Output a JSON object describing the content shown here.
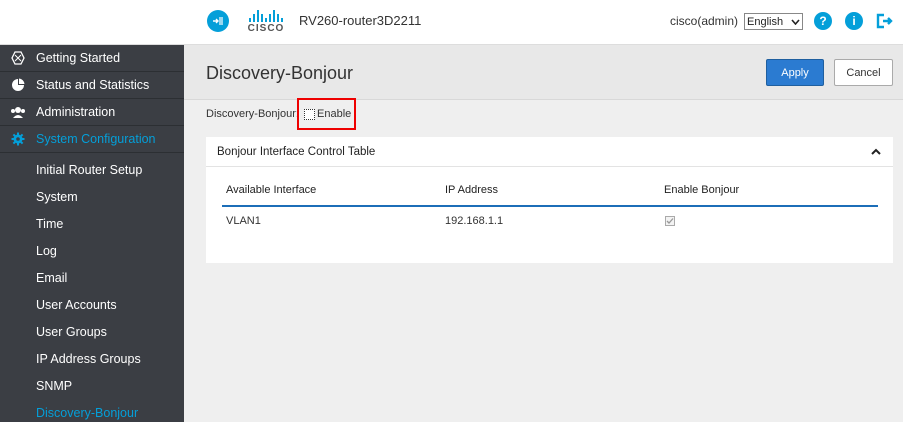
{
  "header": {
    "device_name": "RV260-router3D2211",
    "logo_text": "CISCO",
    "user": "cisco(admin)",
    "language": "English",
    "icons": [
      "nav-toggle-icon",
      "help-icon",
      "info-icon",
      "logout-icon"
    ]
  },
  "sidebar": {
    "items": [
      {
        "label": "Getting Started",
        "icon": "hexagon-icon"
      },
      {
        "label": "Status and Statistics",
        "icon": "pie-chart-icon"
      },
      {
        "label": "Administration",
        "icon": "users-icon"
      },
      {
        "label": "System Configuration",
        "icon": "gear-icon",
        "active": true
      }
    ],
    "subitems": [
      "Initial Router Setup",
      "System",
      "Time",
      "Log",
      "Email",
      "User Accounts",
      "User Groups",
      "IP Address Groups",
      "SNMP",
      "Discovery-Bonjour"
    ],
    "active_subitem": "Discovery-Bonjour"
  },
  "page": {
    "title": "Discovery-Bonjour",
    "apply_label": "Apply",
    "cancel_label": "Cancel",
    "field_label": "Discovery-Bonjour:",
    "enable_label": "Enable",
    "enable_checked": false
  },
  "table": {
    "title": "Bonjour Interface Control Table",
    "columns": [
      "Available Interface",
      "IP Address",
      "Enable Bonjour"
    ],
    "rows": [
      {
        "interface": "VLAN1",
        "ip": "192.168.1.1",
        "enabled": true
      }
    ]
  },
  "colors": {
    "accent": "#049fd9",
    "apply_button": "#2b7bd1",
    "sidebar_bg": "#3b3e44",
    "highlight_box": "#e00000"
  }
}
